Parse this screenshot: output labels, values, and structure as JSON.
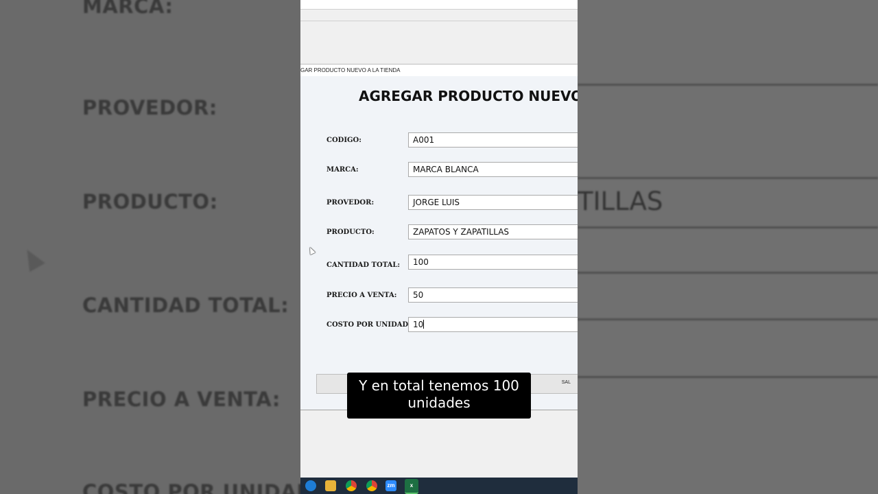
{
  "background": {
    "labels": [
      "MARCA:",
      "PROVEDOR:",
      "PRODUCTO:",
      "CANTIDAD TOTAL:",
      "PRECIO A VENTA:",
      "COSTO POR UNIDAD:"
    ],
    "right_text": "TILLAS"
  },
  "window": {
    "title": "GAR PRODUCTO NUEVO A LA TIENDA"
  },
  "form": {
    "heading": "AGREGAR PRODUCTO NUEVO",
    "fields": [
      {
        "label": "CODIGO:",
        "value": "A001"
      },
      {
        "label": "MARCA:",
        "value": "MARCA BLANCA"
      },
      {
        "label": "PROVEDOR:",
        "value": "JORGE LUIS"
      },
      {
        "label": "PRODUCTO:",
        "value": "ZAPATOS Y ZAPATILLAS"
      },
      {
        "label": "CANTIDAD TOTAL:",
        "value": "100"
      },
      {
        "label": "PRECIO A VENTA:",
        "value": "50"
      },
      {
        "label": "COSTO POR UNIDAD:",
        "value": "10"
      }
    ],
    "button_partial": "SAL"
  },
  "caption": {
    "line1": "Y en total tenemos 100",
    "line2": "unidades"
  },
  "taskbar": {
    "icons": [
      "edge-icon",
      "file-explorer-icon",
      "chrome-icon",
      "chrome-profile-icon",
      "zoom-icon",
      "excel-icon"
    ],
    "zoom_label": "zm",
    "excel_label": "x"
  }
}
